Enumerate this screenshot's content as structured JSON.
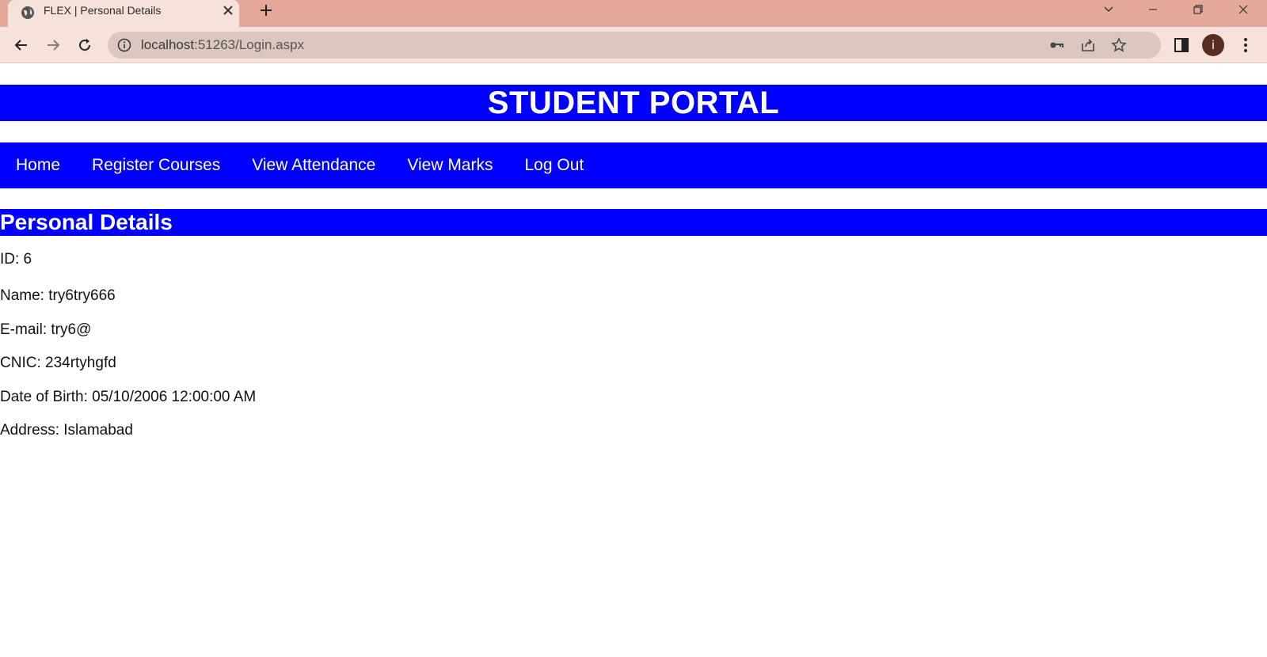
{
  "browser": {
    "tab_title": "FLEX | Personal Details",
    "url_host": "localhost",
    "url_path": ":51263/Login.aspx",
    "avatar_letter": "i"
  },
  "portal": {
    "title": "STUDENT PORTAL",
    "nav": [
      "Home",
      "Register Courses",
      "View Attendance",
      "View Marks",
      "Log Out"
    ]
  },
  "details": {
    "section_title": "Personal Details",
    "id": "ID: 6",
    "name": "Name: try6try666",
    "email": "E-mail: try6@",
    "cnic": "CNIC: 234rtyhgfd",
    "dob": "Date of Birth: 05/10/2006 12:00:00 AM",
    "address": "Address: Islamabad"
  },
  "colors": {
    "banner": "#0000ff",
    "tabstrip": "#e4a99b",
    "toolbar": "#f7e1db"
  }
}
